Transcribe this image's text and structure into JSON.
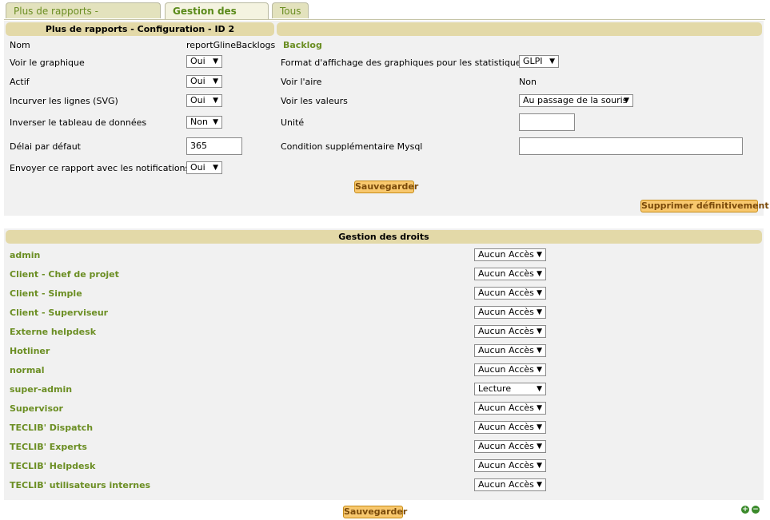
{
  "tabs": [
    {
      "label": "Plus de rapports - Configuration"
    },
    {
      "label": "Gestion des droits"
    },
    {
      "label": "Tous"
    }
  ],
  "config": {
    "header_left": "Plus de rapports - Configuration - ID 2",
    "nom_label": "Nom",
    "nom_value": "reportGlineBacklogs",
    "report_title": "Backlog",
    "voir_graphique_label": "Voir le graphique",
    "voir_graphique_value": "Oui",
    "actif_label": "Actif",
    "actif_value": "Oui",
    "incurver_label": "Incurver les lignes (SVG)",
    "incurver_value": "Oui",
    "inverser_label": "Inverser le tableau de données",
    "inverser_value": "Non",
    "delai_label": "Délai par défaut",
    "delai_value": "365",
    "envoyer_label": "Envoyer ce rapport avec les notifications",
    "envoyer_value": "Oui",
    "format_label": "Format d'affichage des graphiques pour les statistiques",
    "format_value": "GLPI",
    "voir_aire_label": "Voir l'aire",
    "voir_aire_value": "Non",
    "voir_valeurs_label": "Voir les valeurs",
    "voir_valeurs_value": "Au passage de la souris",
    "unite_label": "Unité",
    "unite_value": "",
    "condition_label": "Condition supplémentaire Mysql",
    "condition_value": "",
    "save_label": "Sauvegarder",
    "delete_label": "Supprimer définitivement"
  },
  "rights": {
    "header": "Gestion des droits",
    "profiles": [
      {
        "name": "admin",
        "access": "Aucun Accès"
      },
      {
        "name": "Client - Chef de projet",
        "access": "Aucun Accès"
      },
      {
        "name": "Client - Simple",
        "access": "Aucun Accès"
      },
      {
        "name": "Client - Superviseur",
        "access": "Aucun Accès"
      },
      {
        "name": "Externe helpdesk",
        "access": "Aucun Accès"
      },
      {
        "name": "Hotliner",
        "access": "Aucun Accès"
      },
      {
        "name": "normal",
        "access": "Aucun Accès"
      },
      {
        "name": "super-admin",
        "access": "Lecture"
      },
      {
        "name": "Supervisor",
        "access": "Aucun Accès"
      },
      {
        "name": "TECLIB' Dispatch",
        "access": "Aucun Accès"
      },
      {
        "name": "TECLIB' Experts",
        "access": "Aucun Accès"
      },
      {
        "name": "TECLIB' Helpdesk",
        "access": "Aucun Accès"
      },
      {
        "name": "TECLIB' utilisateurs internes",
        "access": "Aucun Accès"
      }
    ],
    "save_label": "Sauvegarder"
  },
  "icons": {
    "plus": "plus-icon",
    "minus": "minus-icon"
  },
  "colors": {
    "accent_green": "#6b8e23",
    "header_bg": "#e3d9a8",
    "button_bg": "#f8c86e"
  }
}
